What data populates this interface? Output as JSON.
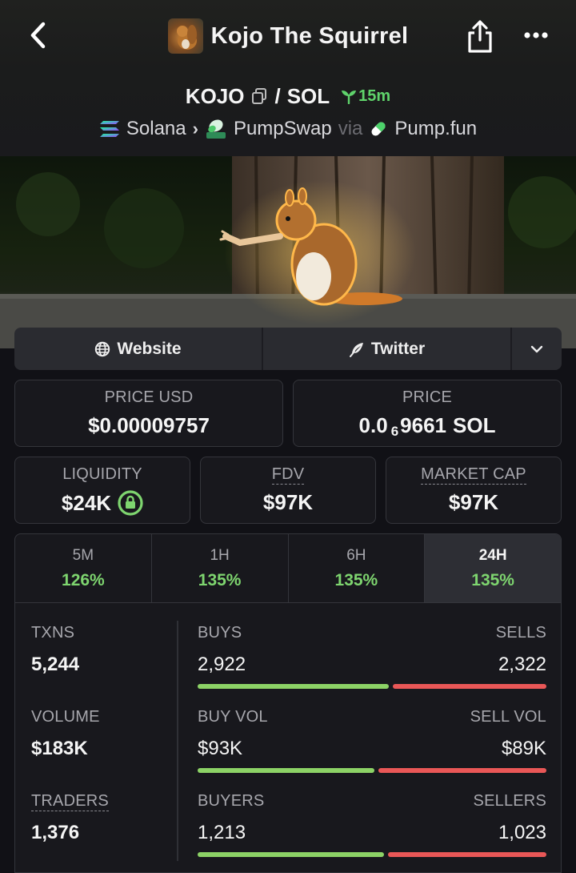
{
  "header": {
    "title": "Kojo The Squirrel",
    "back_icon": "chevron-left-icon",
    "share_icon": "share-icon",
    "more_icon": "more-dots-icon"
  },
  "pair": {
    "base": "KOJO",
    "separator": "/",
    "quote": "SOL",
    "age": "15m"
  },
  "chain": {
    "network": "Solana",
    "dex": "PumpSwap",
    "via": "via",
    "launchpad": "Pump.fun"
  },
  "links": {
    "website": "Website",
    "twitter": "Twitter"
  },
  "price_usd": {
    "label": "PRICE USD",
    "value": "$0.00009757"
  },
  "price_native": {
    "label": "PRICE",
    "prefix": "0.0",
    "zeros": "6",
    "digits": "9661",
    "unit": "SOL"
  },
  "liquidity": {
    "label": "LIQUIDITY",
    "value": "$24K"
  },
  "fdv": {
    "label": "FDV",
    "value": "$97K"
  },
  "market_cap": {
    "label": "MARKET CAP",
    "value": "$97K"
  },
  "periods": [
    {
      "label": "5M",
      "change": "126%"
    },
    {
      "label": "1H",
      "change": "135%"
    },
    {
      "label": "6H",
      "change": "135%"
    },
    {
      "label": "24H",
      "change": "135%",
      "active": true
    }
  ],
  "stats": {
    "txns": {
      "label": "TXNS",
      "value": "5,244"
    },
    "volume": {
      "label": "VOLUME",
      "value": "$183K"
    },
    "traders": {
      "label": "TRADERS",
      "value": "1,376"
    },
    "buys": {
      "label": "BUYS",
      "value": "2,922"
    },
    "sells": {
      "label": "SELLS",
      "value": "2,322"
    },
    "buy_vol": {
      "label": "BUY VOL",
      "value": "$93K"
    },
    "sell_vol": {
      "label": "SELL VOL",
      "value": "$89K"
    },
    "buyers": {
      "label": "BUYERS",
      "value": "1,213"
    },
    "sellers": {
      "label": "SELLERS",
      "value": "1,023"
    }
  },
  "colors": {
    "positive": "#7ed56f",
    "buy_bar": "#8cd266",
    "sell_bar": "#e95757",
    "background": "#111116"
  }
}
